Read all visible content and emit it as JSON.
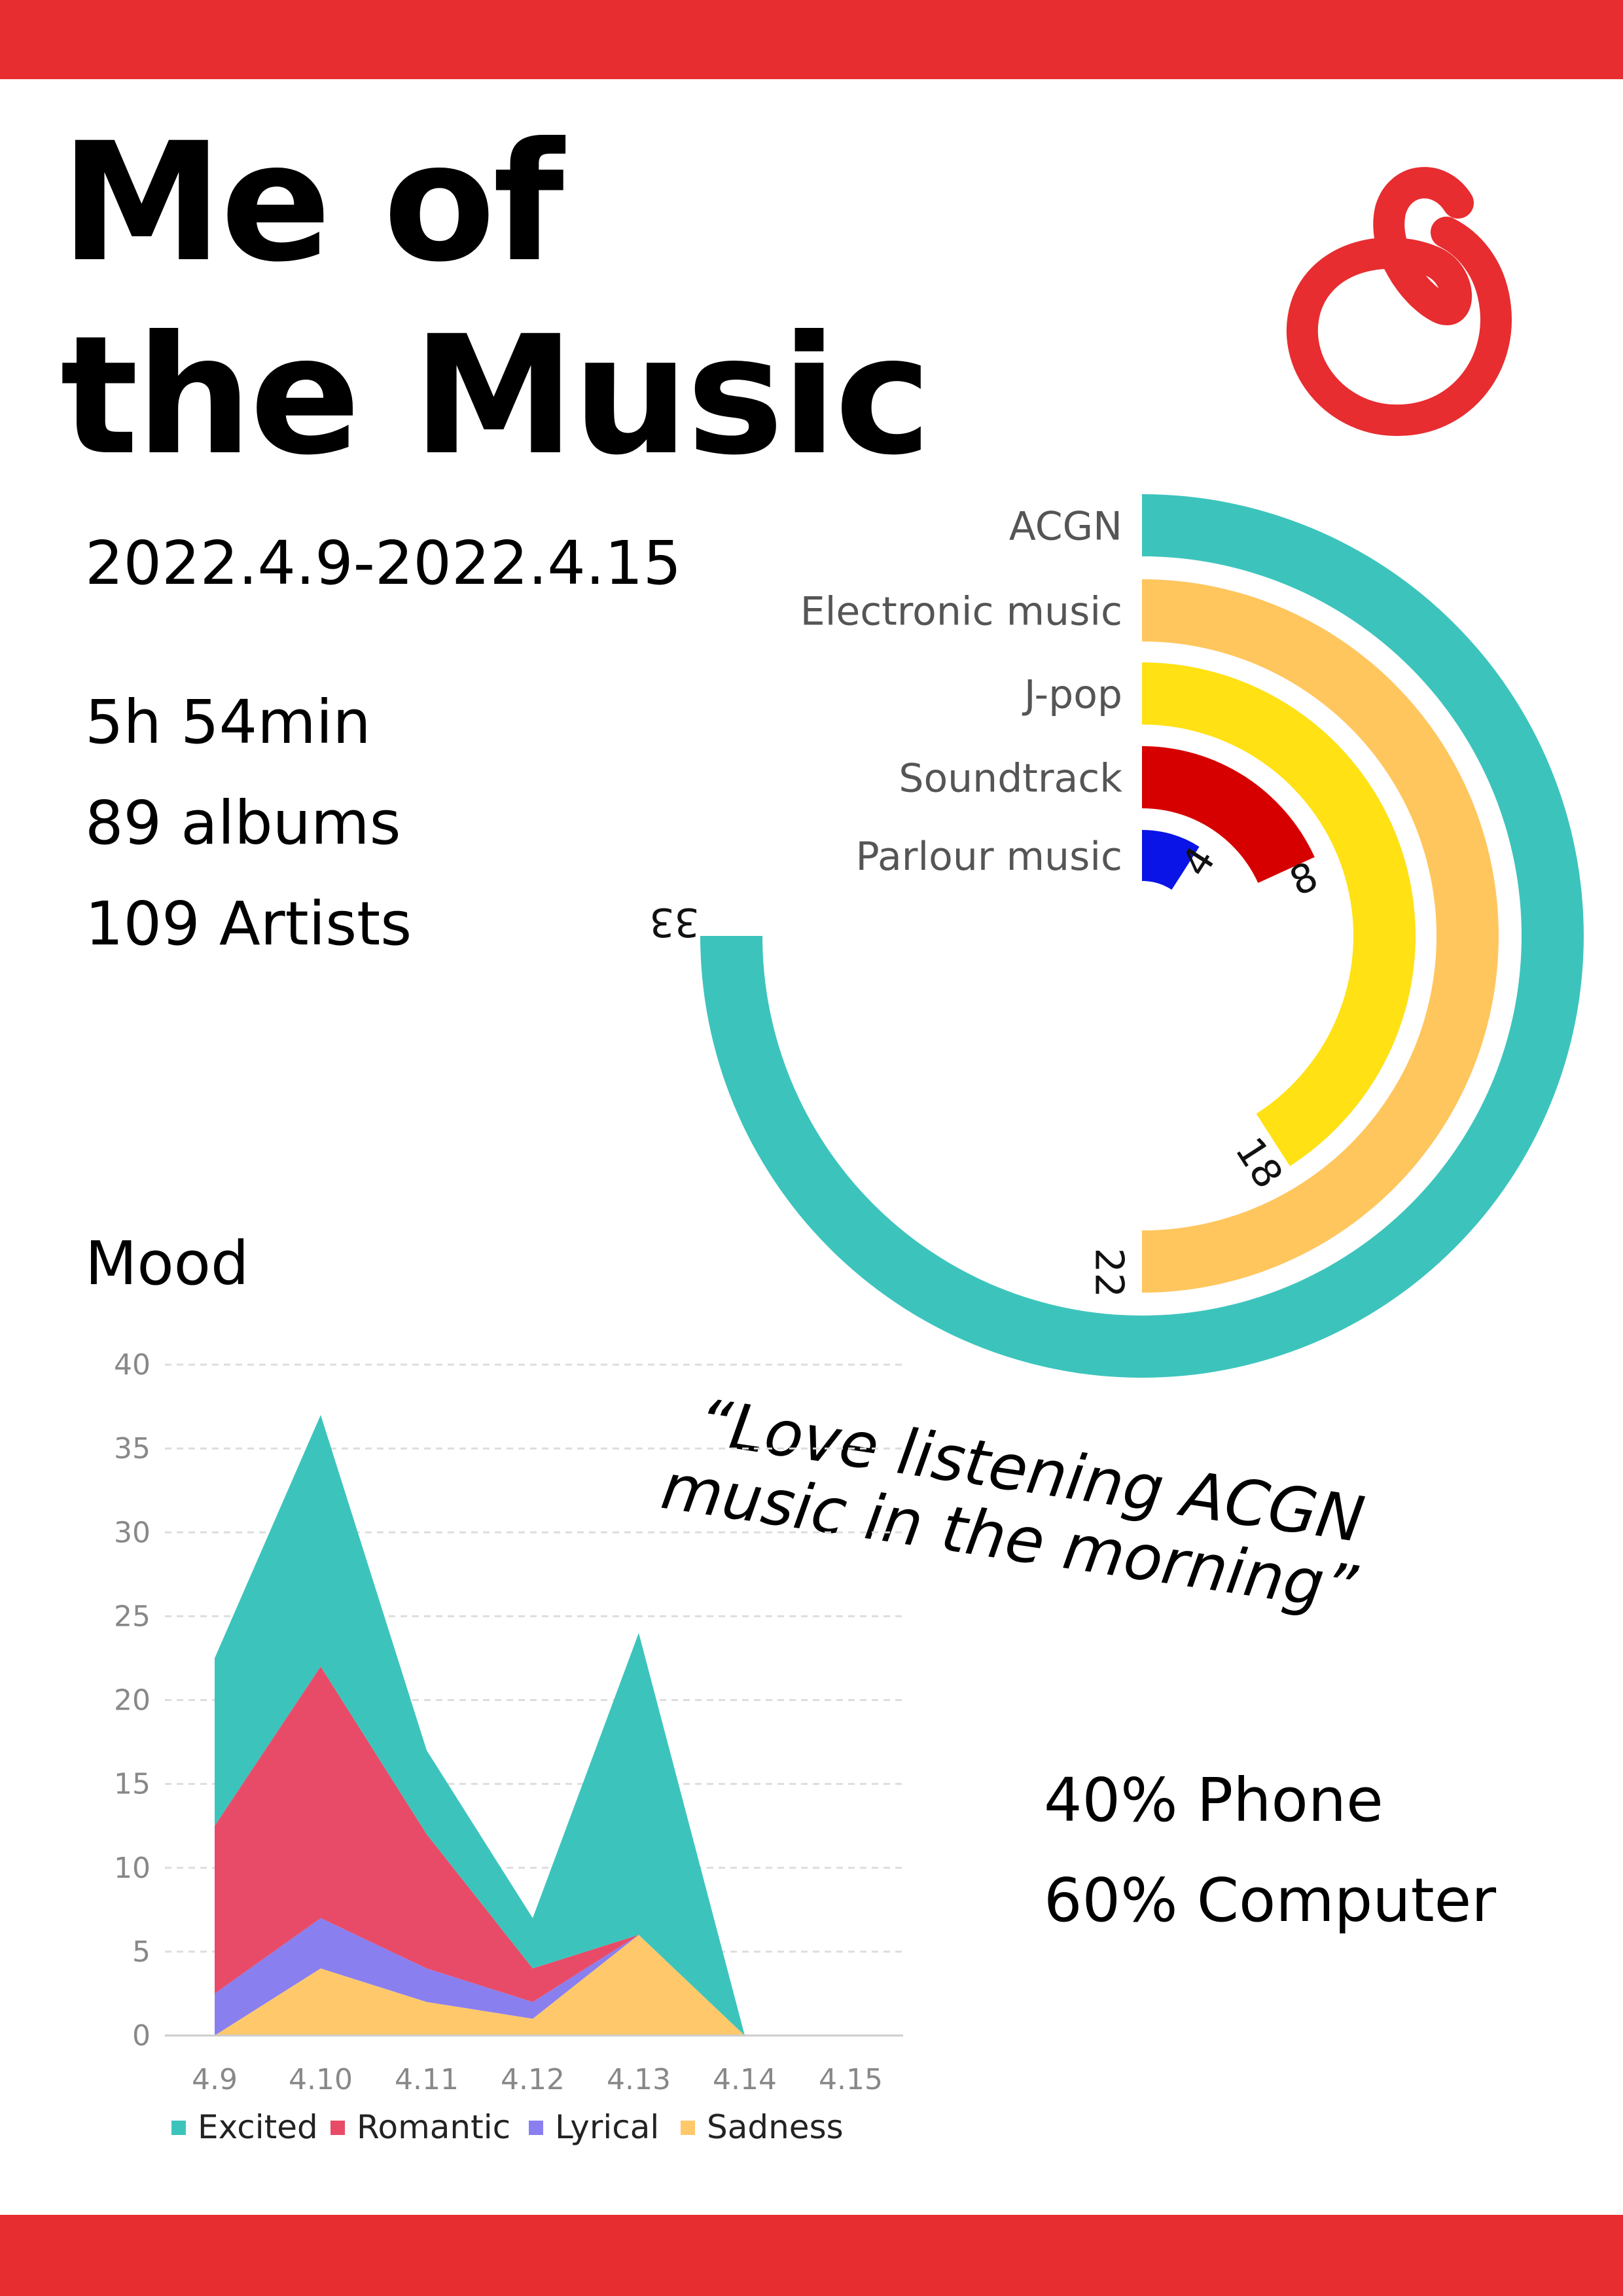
{
  "header": {
    "title_line1": "Me of",
    "title_line2": "the Music"
  },
  "stats": {
    "date_range": "2022.4.9-2022.4.15",
    "listening_time": "5h 54min",
    "albums": "89 albums",
    "artists": "109 Artists"
  },
  "quote": {
    "line1": "“Love listening ACGN",
    "line2": "music in the morning”"
  },
  "devices": {
    "phone": "40% Phone",
    "computer": "60% Computer"
  },
  "logo": {
    "icon": "netease-cloud-music-icon",
    "color": "#E72D30"
  },
  "colors": {
    "accent_band": "#E72D30"
  },
  "chart_data": [
    {
      "type": "radial-bar",
      "categories": [
        "ACGN",
        "Electronic music",
        "J-pop",
        "Soundtrack",
        "Parlour music"
      ],
      "values": [
        33,
        22,
        18,
        8,
        4
      ],
      "value_labels": [
        "33",
        "22",
        "18",
        "8",
        "4"
      ],
      "colors": [
        "#3CC4BC",
        "#FFC65E",
        "#FFE114",
        "#D70000",
        "#0A14E6"
      ],
      "max": 44
    },
    {
      "type": "area",
      "stacked": true,
      "title": "Mood",
      "categories": [
        "4.9",
        "4.10",
        "4.11",
        "4.12",
        "4.13",
        "4.14",
        "4.15"
      ],
      "series": [
        {
          "name": "Sadness",
          "values": [
            0,
            4,
            2,
            1,
            6,
            0,
            0
          ],
          "color": "#FFC96B"
        },
        {
          "name": "Lyrical",
          "values": [
            2.5,
            3,
            2,
            1,
            0,
            0,
            0
          ],
          "color": "#8A7FEF"
        },
        {
          "name": "Romantic",
          "values": [
            10,
            15,
            8,
            2,
            0,
            0,
            0
          ],
          "color": "#E84B67"
        },
        {
          "name": "Excited",
          "values": [
            10,
            15,
            5,
            3,
            18,
            0,
            0
          ],
          "color": "#3CC4BC"
        }
      ],
      "legend_order": [
        "Excited",
        "Romantic",
        "Lyrical",
        "Sadness"
      ],
      "yticks": [
        "0",
        "5",
        "10",
        "15",
        "20",
        "25",
        "30",
        "35",
        "40"
      ],
      "ylim": [
        0,
        40
      ],
      "grid": "dashed horizontal",
      "legend_position": "bottom"
    }
  ]
}
